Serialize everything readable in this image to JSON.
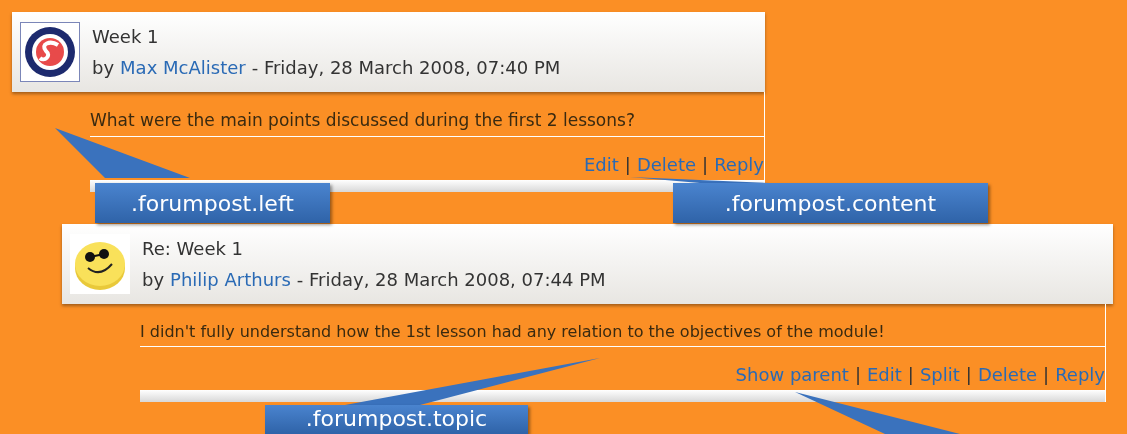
{
  "posts": [
    {
      "title": "Week 1",
      "by": "by",
      "author": "Max McAlister",
      "date": "- Friday, 28 March 2008, 07:40 PM",
      "avatar": {
        "kind": "logo"
      },
      "message": "What were the main points discussed during the first 2 lessons?",
      "separator": "|",
      "actions": [
        "Edit",
        "Delete",
        "Reply"
      ]
    },
    {
      "title": "Re: Week 1",
      "by": "by",
      "author": "Philip Arthurs",
      "date": "- Friday, 28 March 2008, 07:44 PM",
      "avatar": {
        "kind": "smiley"
      },
      "message": "I didn't fully understand how the 1st lesson had any relation to the objectives of the module!",
      "separator": "|",
      "actions": [
        "Show parent",
        "Edit",
        "Split",
        "Delete",
        "Reply"
      ]
    }
  ],
  "callouts": [
    {
      "kind": "labelled",
      "label": ".forumpost.left"
    },
    {
      "kind": "labelled",
      "label": ".forumpost.content"
    },
    {
      "kind": "labelled",
      "label": ".forumpost.topic"
    },
    {
      "kind": "pointer"
    }
  ]
}
